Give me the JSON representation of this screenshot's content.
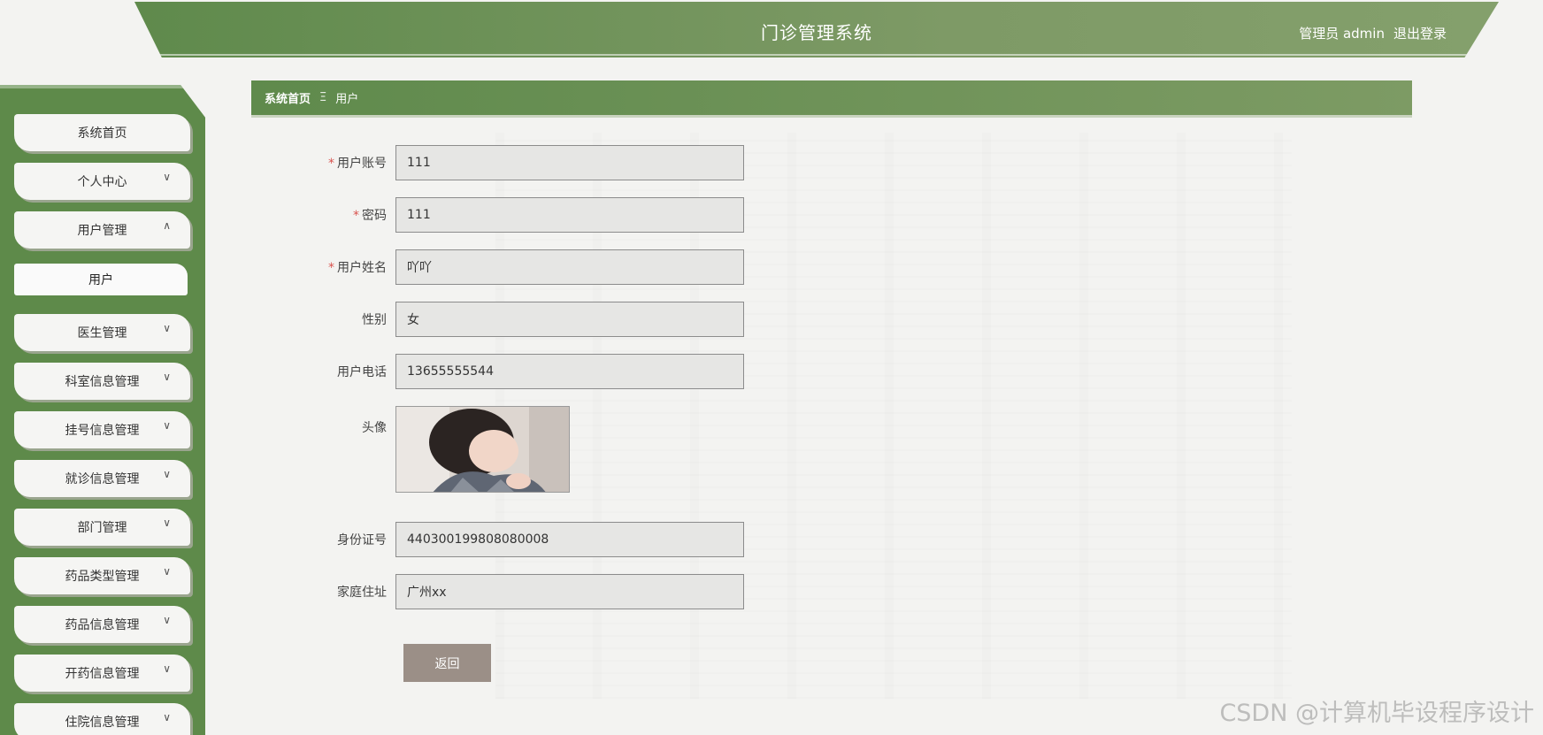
{
  "header": {
    "title": "门诊管理系统",
    "user_label": "管理员 admin",
    "logout_label": "退出登录"
  },
  "sidebar": {
    "items": [
      {
        "label": "系统首页",
        "chevron": ""
      },
      {
        "label": "个人中心",
        "chevron": "∨"
      },
      {
        "label": "用户管理",
        "chevron": "∧"
      },
      {
        "label": "医生管理",
        "chevron": "∨"
      },
      {
        "label": "科室信息管理",
        "chevron": "∨"
      },
      {
        "label": "挂号信息管理",
        "chevron": "∨"
      },
      {
        "label": "就诊信息管理",
        "chevron": "∨"
      },
      {
        "label": "部门管理",
        "chevron": "∨"
      },
      {
        "label": "药品类型管理",
        "chevron": "∨"
      },
      {
        "label": "药品信息管理",
        "chevron": "∨"
      },
      {
        "label": "开药信息管理",
        "chevron": "∨"
      },
      {
        "label": "住院信息管理",
        "chevron": "∨"
      }
    ],
    "sub_item": "用户"
  },
  "breadcrumb": {
    "home": "系统首页",
    "separator": "Ξ",
    "current": "用户"
  },
  "form": {
    "account": {
      "label": "用户账号",
      "value": "111",
      "required": true
    },
    "password": {
      "label": "密码",
      "value": "111",
      "required": true
    },
    "name": {
      "label": "用户姓名",
      "value": "吖吖",
      "required": true
    },
    "gender": {
      "label": "性别",
      "value": "女",
      "required": false
    },
    "phone": {
      "label": "用户电话",
      "value": "13655555544",
      "required": false
    },
    "avatar": {
      "label": "头像"
    },
    "id_number": {
      "label": "身份证号",
      "value": "440300199808080008",
      "required": false
    },
    "address": {
      "label": "家庭住址",
      "value": "广州xx",
      "required": false
    },
    "back_button": "返回"
  },
  "required_mark": "*",
  "watermark": "CSDN @计算机毕设程序设计",
  "colors": {
    "header_green": "#5f8a4c",
    "sidebar_green": "#5e8a4a",
    "button": "#9b8f87",
    "required": "#d9534f"
  }
}
